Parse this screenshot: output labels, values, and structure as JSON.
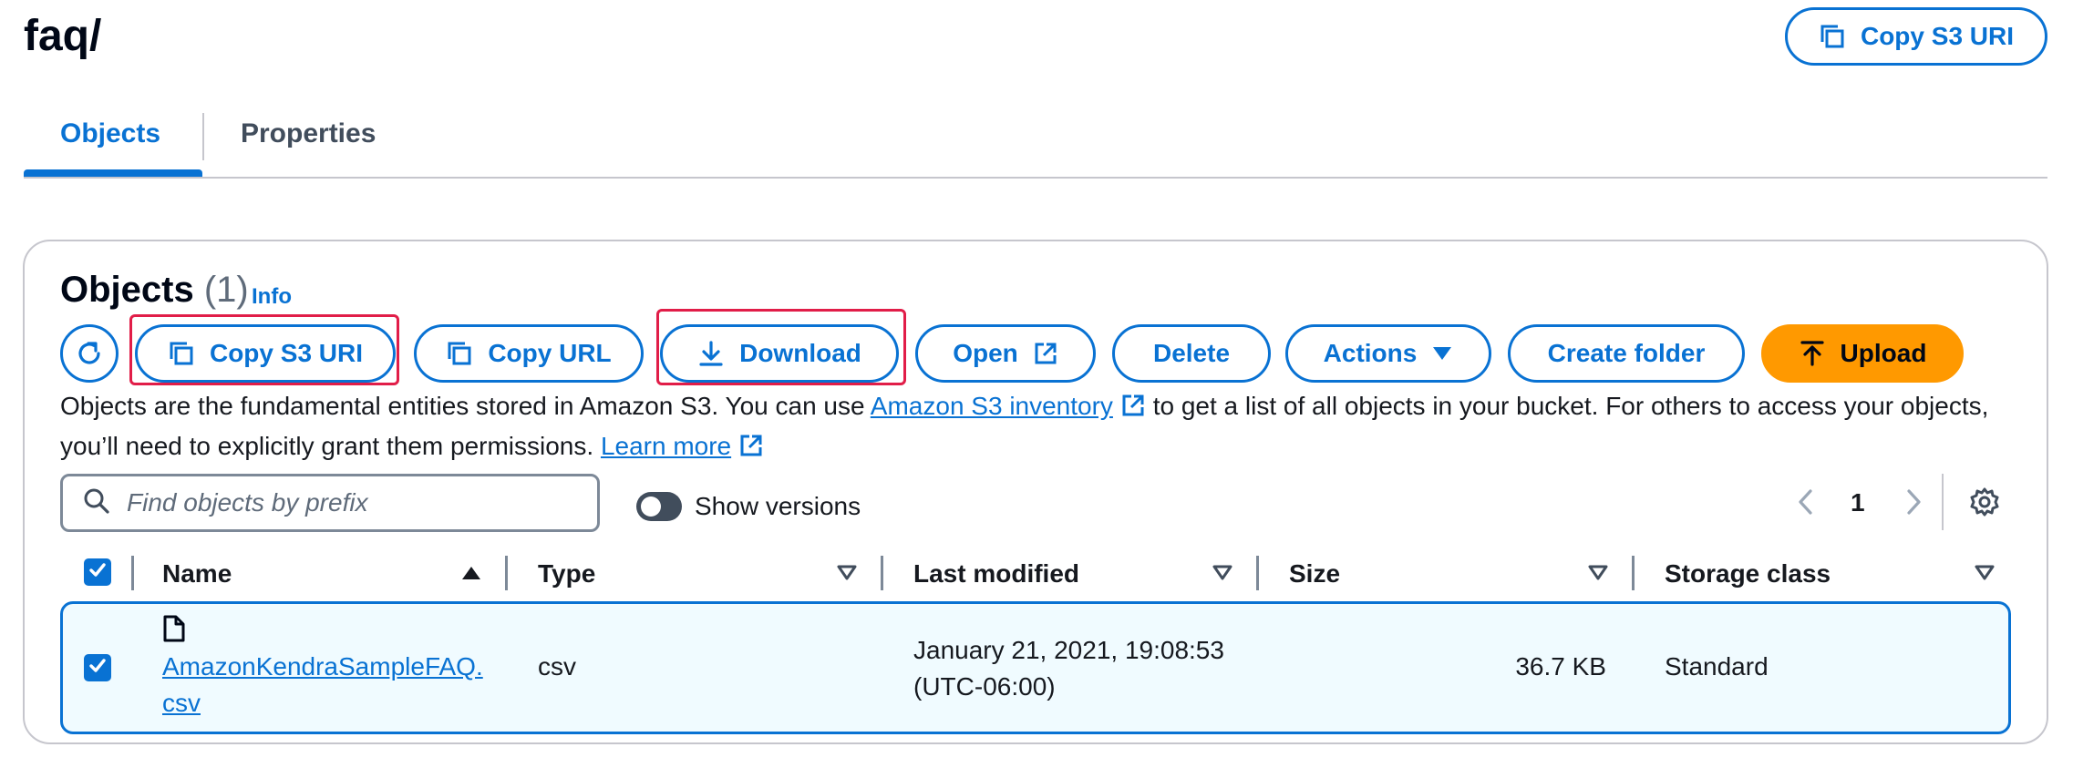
{
  "header": {
    "title": "faq/",
    "copy_s3_uri_label": "Copy S3 URI"
  },
  "tabs": [
    {
      "label": "Objects",
      "active": true
    },
    {
      "label": "Properties",
      "active": false
    }
  ],
  "objects": {
    "heading": "Objects",
    "count": "(1)",
    "info_label": "Info",
    "toolbar": {
      "copy_s3_uri": "Copy S3 URI",
      "copy_url": "Copy URL",
      "download": "Download",
      "open": "Open",
      "delete": "Delete",
      "actions": "Actions",
      "create_folder": "Create folder",
      "upload": "Upload"
    },
    "description": {
      "part1": "Objects are the fundamental entities stored in Amazon S3. You can use ",
      "inventory_link": "Amazon S3 inventory",
      "part2": " to get a list of all objects in your bucket. For others to access your objects, you’ll need to explicitly grant them permissions. ",
      "learn_more": "Learn more"
    },
    "search_placeholder": "Find objects by prefix",
    "show_versions_label": "Show versions",
    "page_number": "1",
    "columns": [
      "Name",
      "Type",
      "Last modified",
      "Size",
      "Storage class"
    ],
    "rows": [
      {
        "name_line1": "AmazonKendraSampleFAQ.",
        "name_line2": "csv",
        "type": "csv",
        "last_modified_line1": "January 21, 2021, 19:08:53",
        "last_modified_line2": "(UTC-06:00)",
        "size": "36.7 KB",
        "storage_class": "Standard",
        "selected": true
      }
    ]
  },
  "colors": {
    "accent": "#0972d3",
    "primary_button": "#ff9900",
    "highlight_box": "#e11d48"
  },
  "icons": [
    "copy-icon",
    "refresh-icon",
    "download-icon",
    "external-link-icon",
    "caret-down-icon",
    "upload-icon",
    "search-icon",
    "chevron-left-icon",
    "chevron-right-icon",
    "gear-icon",
    "file-icon",
    "check-icon",
    "sort-ascending-icon",
    "sort-descending-icon"
  ]
}
